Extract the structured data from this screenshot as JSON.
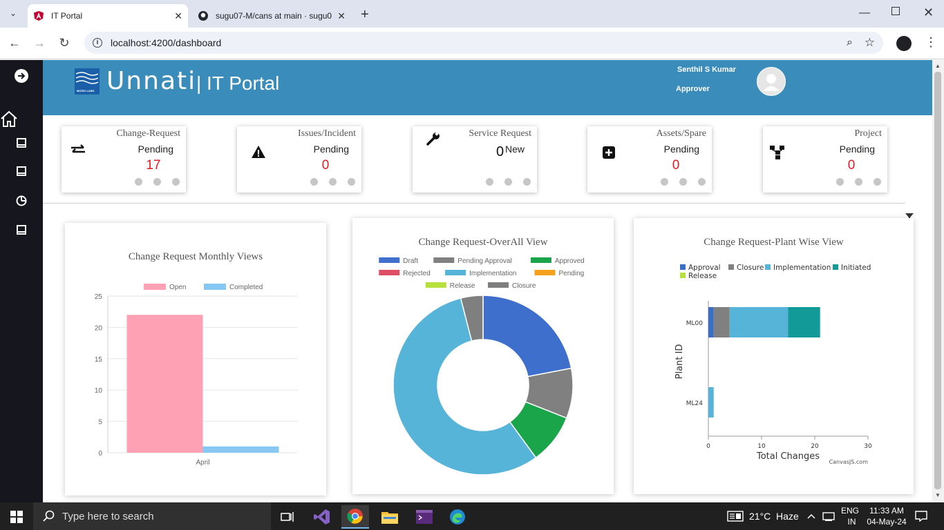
{
  "browser": {
    "tabs": [
      {
        "title": "IT Portal",
        "active": true
      },
      {
        "title": "sugu07-M/cans at main · sugu0",
        "active": false
      }
    ],
    "url": "localhost:4200/dashboard"
  },
  "header": {
    "logo_text": "MICRO LABS",
    "brand": "Unnati",
    "portal": "| IT Portal",
    "user_name": "Senthil S Kumar",
    "user_role": "Approver"
  },
  "cards": [
    {
      "title": "Change-Request",
      "status": "Pending",
      "count": "17"
    },
    {
      "title": "Issues/Incident",
      "status": "Pending",
      "count": "0"
    },
    {
      "title": "Service Request",
      "status": "New",
      "count": "0"
    },
    {
      "title": "Assets/Spare",
      "status": "Pending",
      "count": "0"
    },
    {
      "title": "Project",
      "status": "Pending",
      "count": "0"
    }
  ],
  "chart_data": [
    {
      "type": "bar",
      "title": "Change Request Monthly Views",
      "categories": [
        "April"
      ],
      "series": [
        {
          "name": "Open",
          "values": [
            22
          ],
          "color": "#ffa1b5"
        },
        {
          "name": "Completed",
          "values": [
            1
          ],
          "color": "#86c7f3"
        }
      ],
      "ylim": [
        0,
        25
      ],
      "yticks": [
        "0",
        "5",
        "10",
        "15",
        "20",
        "25"
      ],
      "legend": "top",
      "grid": true
    },
    {
      "type": "pie",
      "title": "Change Request-OverAll View",
      "labels": [
        "Draft",
        "Pending Approval",
        "Approved",
        "Rejected",
        "Implementation",
        "Pending",
        "Release",
        "Closure"
      ],
      "values": [
        22,
        9,
        9,
        0,
        56,
        0,
        0,
        4
      ],
      "colors": [
        "#3f6fcd",
        "#808080",
        "#1aa54b",
        "#de4e64",
        "#56b4d8",
        "#f4a21e",
        "#b6e03e",
        "#7f7f7f"
      ],
      "legend": "top"
    },
    {
      "type": "bar",
      "orientation": "horizontal",
      "stacked": true,
      "title": "Change Request-Plant Wise View",
      "categories": [
        "ML00",
        "ML24"
      ],
      "series": [
        {
          "name": "Approval",
          "values": [
            1,
            0
          ],
          "color": "#3a6dc8"
        },
        {
          "name": "Closure",
          "values": [
            3,
            0
          ],
          "color": "#808080"
        },
        {
          "name": "Implementation",
          "values": [
            11,
            1
          ],
          "color": "#56b4d8"
        },
        {
          "name": "Initiated",
          "values": [
            6,
            0
          ],
          "color": "#129a98"
        },
        {
          "name": "Release",
          "values": [
            0,
            0
          ],
          "color": "#b6e03e"
        }
      ],
      "xlabel": "Total Changes",
      "ylabel": "Plant ID",
      "xlim": [
        0,
        30
      ],
      "xticks": [
        "0",
        "10",
        "20",
        "30"
      ],
      "credit": "CanvasJS.com",
      "legend": "top"
    }
  ],
  "taskbar": {
    "search_placeholder": "Type here to search",
    "weather": "21°C  Haze",
    "lang_top": "ENG",
    "lang_bottom": "IN",
    "time": "11:33 AM",
    "date": "04-May-24"
  }
}
